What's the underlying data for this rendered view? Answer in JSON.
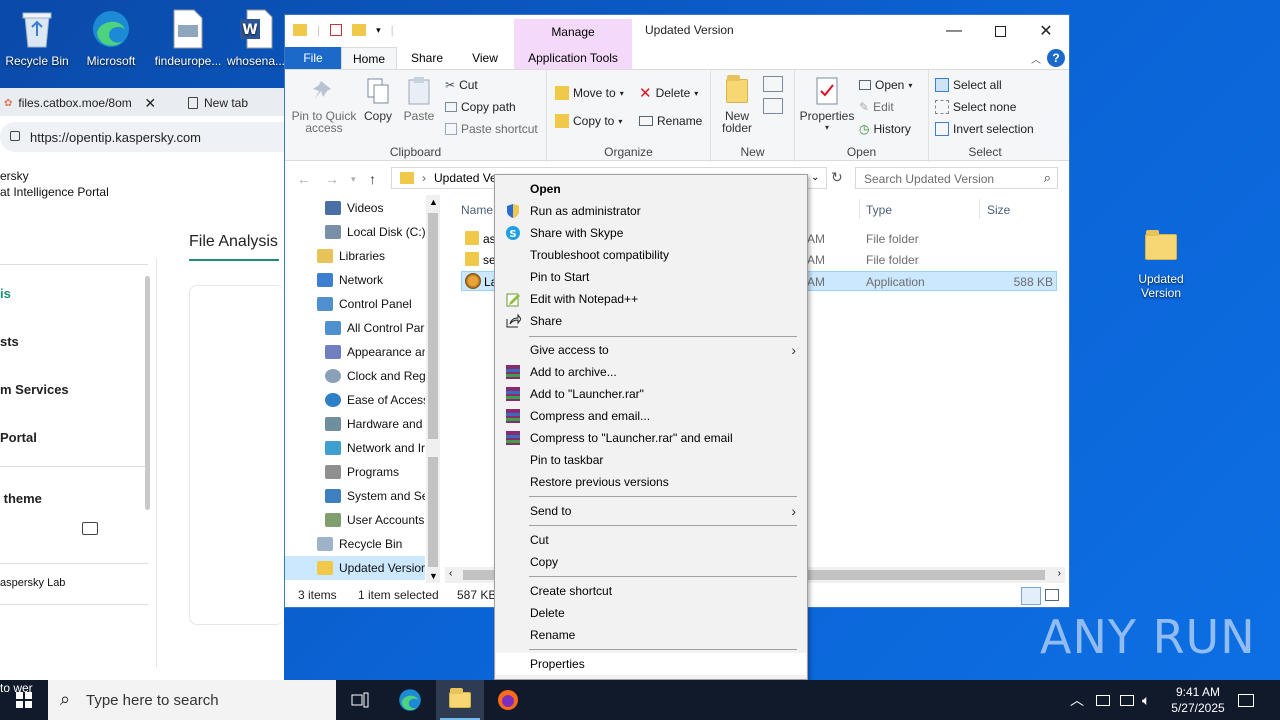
{
  "desktop": {
    "icons": [
      {
        "label": "Recycle Bin"
      },
      {
        "label": "Microsoft Edge"
      },
      {
        "label": "findeurope..."
      },
      {
        "label": "whosena..."
      },
      {
        "label": "Updated Version"
      }
    ],
    "watermark": "ANY RUN"
  },
  "browser": {
    "tab1": "files.catbox.moe/8om",
    "tab2": "New tab",
    "url": "https://opentip.kaspersky.com",
    "brand_line1": "ersky",
    "brand_line2": "at Intelligence Portal",
    "nav": [
      "is",
      "sts",
      "m Services",
      "Portal",
      " theme"
    ],
    "footer": "aspersky Lab",
    "file_analysis_tab": "File Analysis",
    "bottom_text": "to wer"
  },
  "explorer": {
    "title": "Updated Version",
    "manage": "Manage",
    "tabs": {
      "file": "File",
      "home": "Home",
      "share": "Share",
      "view": "View",
      "app_tools": "Application Tools"
    },
    "clipboard": {
      "pin": "Pin to Quick access",
      "copy": "Copy",
      "paste": "Paste",
      "cut": "Cut",
      "copy_path": "Copy path",
      "paste_shortcut": "Paste shortcut",
      "label": "Clipboard"
    },
    "organize": {
      "move_to": "Move to",
      "copy_to": "Copy to",
      "delete": "Delete",
      "rename": "Rename",
      "label": "Organize"
    },
    "new": {
      "new_folder": "New folder",
      "label": "New"
    },
    "open": {
      "properties": "Properties",
      "open": "Open",
      "edit": "Edit",
      "history": "History",
      "label": "Open"
    },
    "select": {
      "select_all": "Select all",
      "select_none": "Select none",
      "invert": "Invert selection",
      "label": "Select"
    },
    "path": "Updated Ver",
    "search_placeholder": "Search Updated Version",
    "nav_pane": [
      {
        "label": "Videos",
        "color": "#4a6fa5"
      },
      {
        "label": "Local Disk (C:)",
        "color": "#7a8fa8"
      },
      {
        "label": "Libraries",
        "color": "#e8c35a"
      },
      {
        "label": "Network",
        "color": "#3c7fd1"
      },
      {
        "label": "Control Panel",
        "color": "#4f8fcf"
      },
      {
        "label": "All Control Par",
        "color": "#4f8fcf"
      },
      {
        "label": "Appearance an",
        "color": "#6f7fbf"
      },
      {
        "label": "Clock and Regi",
        "color": "#8aa0b8"
      },
      {
        "label": "Ease of Access",
        "color": "#2f7fc9"
      },
      {
        "label": "Hardware and",
        "color": "#6f8f9f"
      },
      {
        "label": "Network and Ir",
        "color": "#3f9fcf"
      },
      {
        "label": "Programs",
        "color": "#8f8f8f"
      },
      {
        "label": "System and Se",
        "color": "#3f7fbf"
      },
      {
        "label": "User Accounts",
        "color": "#7f9f6f"
      },
      {
        "label": "Recycle Bin",
        "color": "#9fb3c8"
      },
      {
        "label": "Updated Version",
        "color": "#f0c94a"
      }
    ],
    "columns": {
      "name": "Name",
      "type": "Type",
      "size": "Size"
    },
    "files": [
      {
        "name": "as",
        "time": "AM",
        "type": "File folder",
        "size": ""
      },
      {
        "name": "se",
        "time": "AM",
        "type": "File folder",
        "size": ""
      },
      {
        "name": "La",
        "time": "AM",
        "type": "Application",
        "size": "588 KB"
      }
    ],
    "status": {
      "items": "3 items",
      "selected": "1 item selected",
      "size": "587 KB"
    }
  },
  "context_menu": {
    "items": [
      "Open",
      "Run as administrator",
      "Share with Skype",
      "Troubleshoot compatibility",
      "Pin to Start",
      "Edit with Notepad++",
      "Share",
      "Give access to",
      "Add to archive...",
      "Add to \"Launcher.rar\"",
      "Compress and email...",
      "Compress to \"Launcher.rar\" and email",
      "Pin to taskbar",
      "Restore previous versions",
      "Send to",
      "Cut",
      "Copy",
      "Create shortcut",
      "Delete",
      "Rename",
      "Properties"
    ]
  },
  "taskbar": {
    "search_placeholder": "Type here to search",
    "time": "9:41 AM",
    "date": "5/27/2025"
  },
  "colors": {
    "accent": "#1b6ac9",
    "selection": "#cce8ff",
    "manage": "#f4d9fa"
  }
}
